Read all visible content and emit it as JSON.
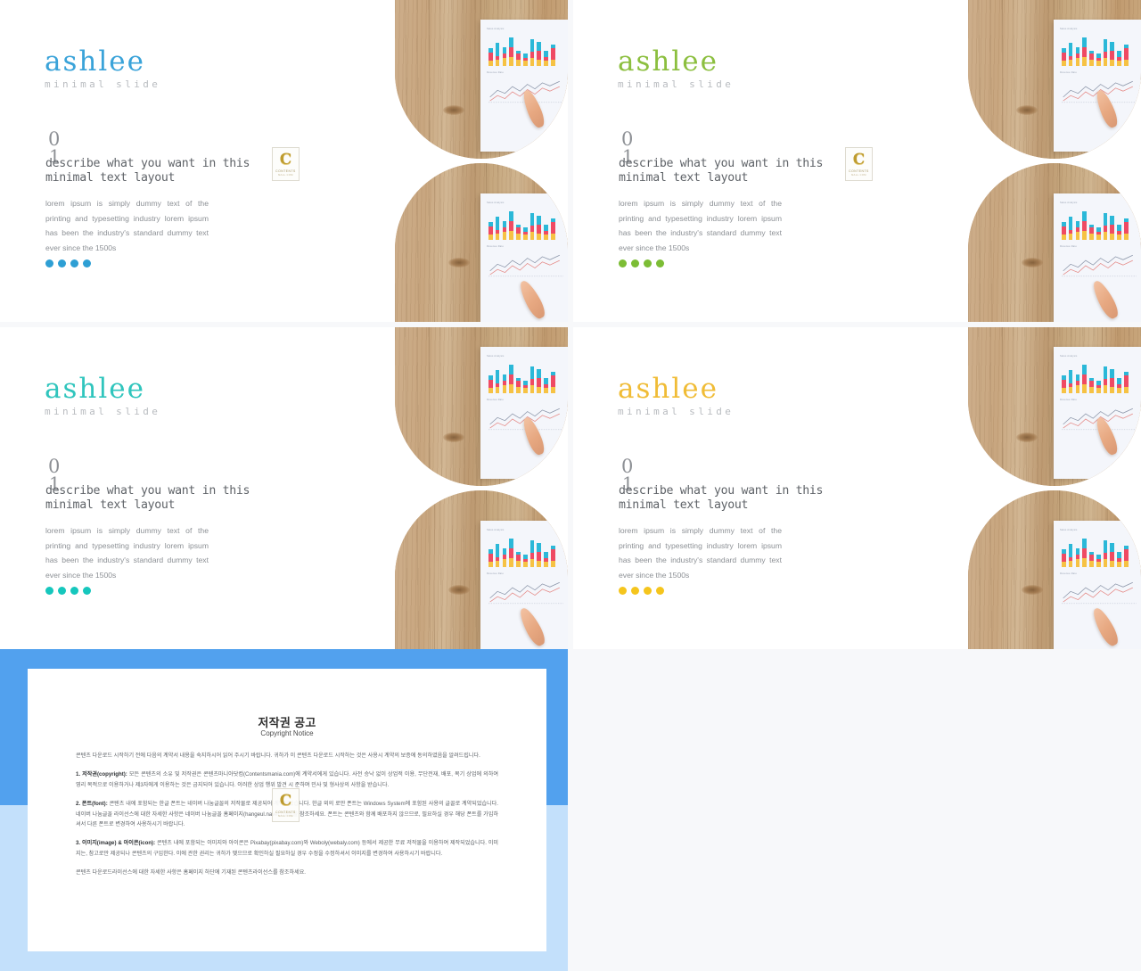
{
  "deck": {
    "slides": [
      {
        "id": "slide-blue",
        "brand": "ashlee",
        "subtitle": "minimal slide",
        "number_top": "0",
        "number_bottom": "1",
        "headline": "describe what you want in this minimal text layout",
        "paragraph": "lorem ipsum is simply dummy text of the printing and typesetting industry lorem ipsum has been the industry's standard dummy text ever since the 1500s",
        "accent": "#3aa3d9",
        "dot_color": "#2e9fd4",
        "dots": 4
      },
      {
        "id": "slide-green",
        "brand": "ashlee",
        "subtitle": "minimal slide",
        "number_top": "0",
        "number_bottom": "1",
        "headline": "describe what you want in this minimal text layout",
        "paragraph": "lorem ipsum is simply dummy text of the printing and typesetting industry lorem ipsum has been the industry's standard dummy text ever since the 1500s",
        "accent": "#8cbf3f",
        "dot_color": "#7cbd35",
        "dots": 4
      },
      {
        "id": "slide-teal",
        "brand": "ashlee",
        "subtitle": "minimal slide",
        "number_top": "0",
        "number_bottom": "1",
        "headline": "describe what you want in this minimal text layout",
        "paragraph": "lorem ipsum is simply dummy text of the printing and typesetting industry lorem ipsum has been the industry's standard dummy text ever since the 1500s",
        "accent": "#30c5bd",
        "dot_color": "#16c7bd",
        "dots": 4
      },
      {
        "id": "slide-yellow",
        "brand": "ashlee",
        "subtitle": "minimal slide",
        "number_top": "0",
        "number_bottom": "1",
        "headline": "describe what you want in this minimal text layout",
        "paragraph": "lorem ipsum is simply dummy text of the printing and typesetting industry lorem ipsum has been the industry's standard dummy text ever since the 1500s",
        "accent": "#f0bc36",
        "dot_color": "#f5c51d",
        "dots": 4
      }
    ]
  },
  "watermark": {
    "letter": "C",
    "line1": "CONTENTS",
    "line2": "MALL.COM"
  },
  "photo": {
    "alt": "hand pointing at a printed bar and line chart report on a wooden desk",
    "chart_label_top": "Sales Analysis",
    "chart_label_bottom": "Revenue Rate"
  },
  "copyright": {
    "title": "저작권 공고",
    "subtitle": "Copyright Notice",
    "intro": "콘텐츠 다운로드 시작하기 전에 다음의 계약서 내용을 숙지하시어 읽어 주시기 바랍니다. 귀하가 이 콘텐츠 다운로드 시작하는 것은 사용시 계약의 보증에 동의하였음을 알려드립니다.",
    "sections": [
      {
        "heading": "1. 저작권(copyright):",
        "text": "모든 콘텐츠의 소유 및 저작권은 콘텐츠마니아닷컴(Contentsmania.com)에 계약서에게 있습니다. 사전 승낙 없이 상업적 이용, 무단전재, 배포, 복기 상업에 의하여 영리 목적으로 이용하거나 제3자에게 이용하는 것은 금지되어 있습니다. 이러한 상업 행위 발견 시 준하며 민사 및 형사상의 사항을 받습니다."
      },
      {
        "heading": "2. 폰트(font):",
        "text": "콘텐츠 내에 포함되는 한글 폰트는 네이버 나눔글꼴의 저작물로 제공되어 계약되었습니다. 한글 외의 로만 폰트는 Windows System에 포함된 사용의 글꼴로 계약되었습니다. 네이버 나눔글꼴 라이선스에 대한 자세한 사항은 네이버 나눔글꼴 홈페이지(hangeul.naver.com)를 참조하세요. 폰트는 콘텐츠와 함께 배포하지 않으므로, 필요하실 경우 해당 폰트를 가입하셔서 다른 폰트로 변경하여 사용하시기 바랍니다."
      },
      {
        "heading": "3. 이미지(image) & 아이콘(icon):",
        "text": "콘텐츠 내에 포함되는 이미지와 아이콘은 Pixabay(pixabay.com)와 Weboly(webaly.com) 등에서 제공한 무료 저작물을 이용하여 제작되었습니다. 이미지는, 참고로만 제공되나 콘텐츠의 구입한다. 이에 관한 권리는 귀하가 맺으므로 확인하실 필요하실 경우 수정을 수정하셔서 이미지를 변경하여 사용하시기 바랍니다."
      }
    ],
    "outro": "콘텐츠 다운로드라이선스에 대한 자세한 사항은 홈페이지 하단에 기재된 콘텐츠라이선스를 참조하세요."
  }
}
